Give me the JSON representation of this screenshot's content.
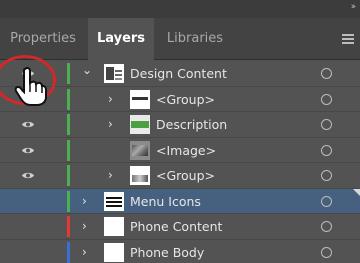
{
  "tabs": [
    {
      "label": "Properties",
      "active": false
    },
    {
      "label": "Layers",
      "active": true
    },
    {
      "label": "Libraries",
      "active": false
    }
  ],
  "layers": [
    {
      "name": "Design Content",
      "visible": true,
      "color": "#4caf50",
      "indent": 0,
      "expander": "expanded",
      "thumb": "design"
    },
    {
      "name": "<Group>",
      "visible": false,
      "color": "#4caf50",
      "indent": 1,
      "expander": "collapsed",
      "thumb": "group1"
    },
    {
      "name": "Description",
      "visible": true,
      "color": "#4caf50",
      "indent": 1,
      "expander": "collapsed",
      "thumb": "desc"
    },
    {
      "name": "<Image>",
      "visible": true,
      "color": "#4caf50",
      "indent": 1,
      "expander": "none",
      "thumb": "image"
    },
    {
      "name": "<Group>",
      "visible": true,
      "color": "#4caf50",
      "indent": 1,
      "expander": "collapsed",
      "thumb": "group2"
    },
    {
      "name": "Menu Icons",
      "visible": false,
      "color": "#4caf50",
      "indent": 0,
      "expander": "collapsed",
      "thumb": "menu",
      "selected": true
    },
    {
      "name": "Phone Content",
      "visible": false,
      "color": "#e53935",
      "indent": 0,
      "expander": "collapsed",
      "thumb": "blank"
    },
    {
      "name": "Phone Body",
      "visible": false,
      "color": "#3b6fd4",
      "indent": 0,
      "expander": "collapsed",
      "thumb": "blank"
    }
  ],
  "colors": {
    "panel_bg": "#535353",
    "selected_row": "#46607f",
    "highlight_circle": "#d1282a"
  },
  "icons": {
    "collapse": "double-chevron-right-icon",
    "panel_menu": "hamburger-menu-icon",
    "visibility": "eye-icon",
    "target": "target-circle-icon",
    "cursor": "hand-pointer-icon"
  }
}
